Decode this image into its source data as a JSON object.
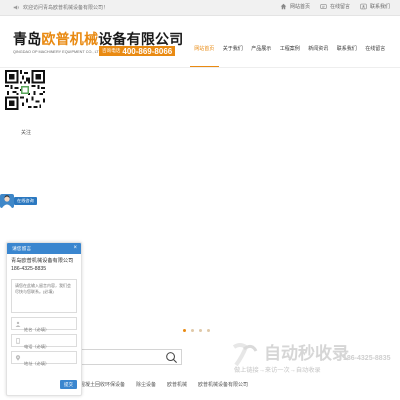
{
  "topbar": {
    "welcome": "欢迎访问青岛欧普机械设备有限公司！",
    "links": [
      "网站首页",
      "在线留言",
      "联系我们"
    ]
  },
  "header": {
    "brand_part1": "青岛",
    "brand_part2": "欧普机械",
    "brand_part3": "设备有限公司",
    "brand_en": "QINGDAO OP MACHINERY EQUIPMENT CO., LTD.",
    "hotline_label": "咨询电话",
    "hotline_number": "400-869-8066"
  },
  "nav": {
    "items": [
      "网站首页",
      "关于我们",
      "产品展示",
      "工程案例",
      "新闻资讯",
      "联系我们",
      "在线留言"
    ],
    "active_index": 0
  },
  "qr": {
    "label": "关注"
  },
  "consult": {
    "label": "在线咨询"
  },
  "slider": {
    "dot_count": 4,
    "active_dot": 0
  },
  "popup": {
    "title": "请您留言",
    "close": "×",
    "company": "青岛欧普机械设备有限公司186-4325-8835",
    "textarea_placeholder": "请您在此输入留言内容，我们会尽快与您联系。(必填)",
    "name_placeholder": "姓名（必填）",
    "phone_placeholder": "电话（必填）",
    "address_placeholder": "地址（必填）",
    "submit": "提交"
  },
  "bottom": {
    "categories": [
      "混凝土回收环保设备",
      "除尘设备",
      "欧普机械",
      "欧普机械设备有限公司"
    ],
    "phone_partial": "186-4325-8835"
  },
  "watermark": {
    "text": "自动秒收录",
    "sub": "做上链接→来访一次→自动收录"
  },
  "colors": {
    "accent_orange": "#e98a12",
    "popup_blue": "#3a86cf",
    "topbar_bg": "#f1f1f1"
  }
}
